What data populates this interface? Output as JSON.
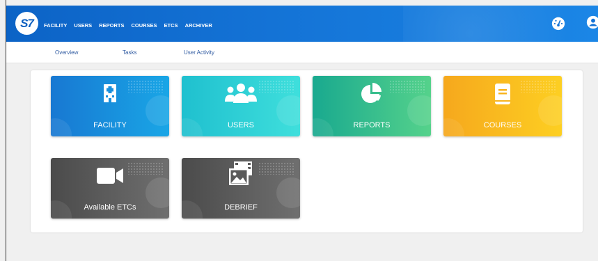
{
  "app": {
    "logo_text": "S7"
  },
  "main_nav": [
    "FACILITY",
    "USERS",
    "REPORTS",
    "COURSES",
    "ETCS",
    "ARCHIVER"
  ],
  "sub_nav": [
    "Overview",
    "Tasks",
    "User Activity"
  ],
  "tiles": [
    {
      "label": "FACILITY",
      "icon": "hospital-building-icon"
    },
    {
      "label": "USERS",
      "icon": "users-group-icon"
    },
    {
      "label": "REPORTS",
      "icon": "pie-chart-icon"
    },
    {
      "label": "COURSES",
      "icon": "book-icon"
    },
    {
      "label": "Available ETCs",
      "icon": "video-camera-icon"
    },
    {
      "label": "DEBRIEF",
      "icon": "media-gallery-icon"
    }
  ],
  "header_icons": [
    "dashboard-gauge-icon",
    "user-account-icon"
  ],
  "colors": {
    "header": "#1473d6",
    "facility": "#19a6e6",
    "users": "#3fdfdc",
    "reports": "#55d28b",
    "courses": "#fdcf22",
    "gray_tiles": "#5e5e5e",
    "subnav_link": "#2f5aa1"
  }
}
